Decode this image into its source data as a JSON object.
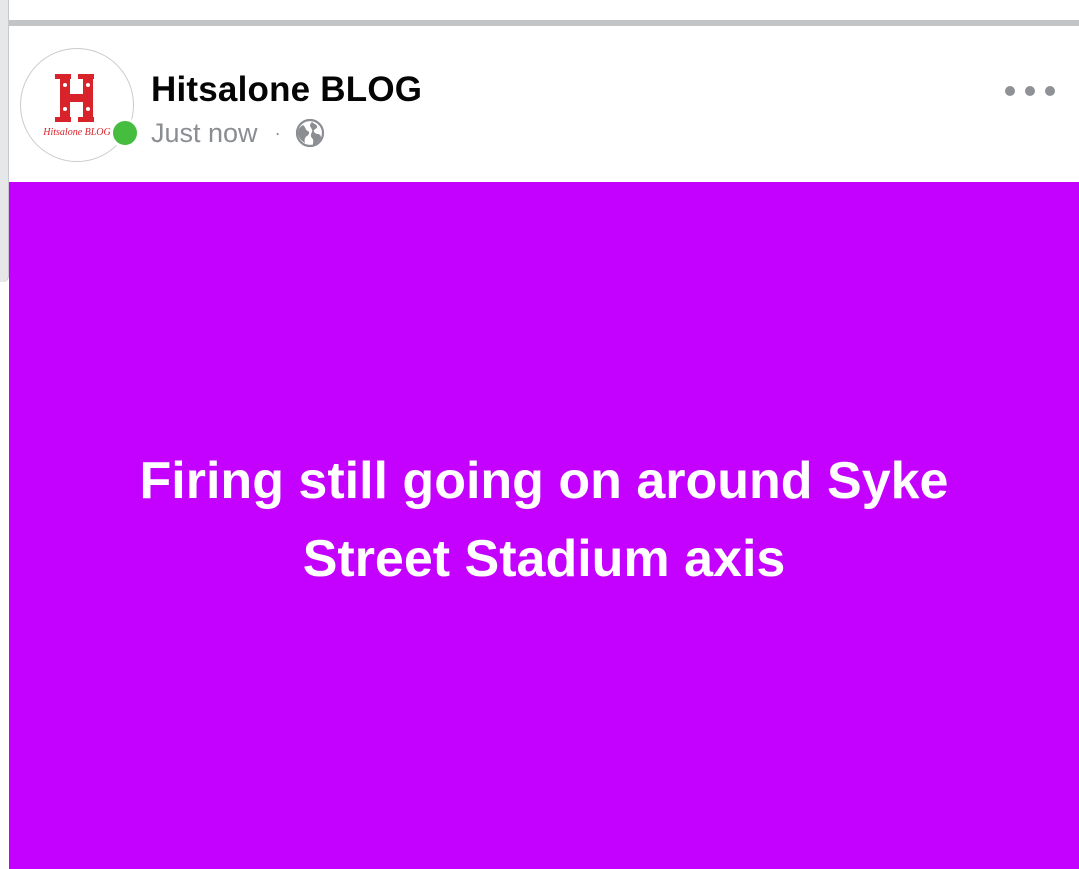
{
  "post": {
    "author_name": "Hitsalone BLOG",
    "timestamp": "Just now",
    "separator": "·",
    "privacy_icon": "globe-icon",
    "more_icon": "more-options-icon",
    "avatar_logo_letter": "H",
    "avatar_logo_text": "Hitsalone BLOG",
    "online_status_color": "#45bd3e",
    "body_text": "Firing still going on around Syke Street Stadium axis",
    "body_background": "#c400ff",
    "body_text_color": "#ffffff"
  }
}
